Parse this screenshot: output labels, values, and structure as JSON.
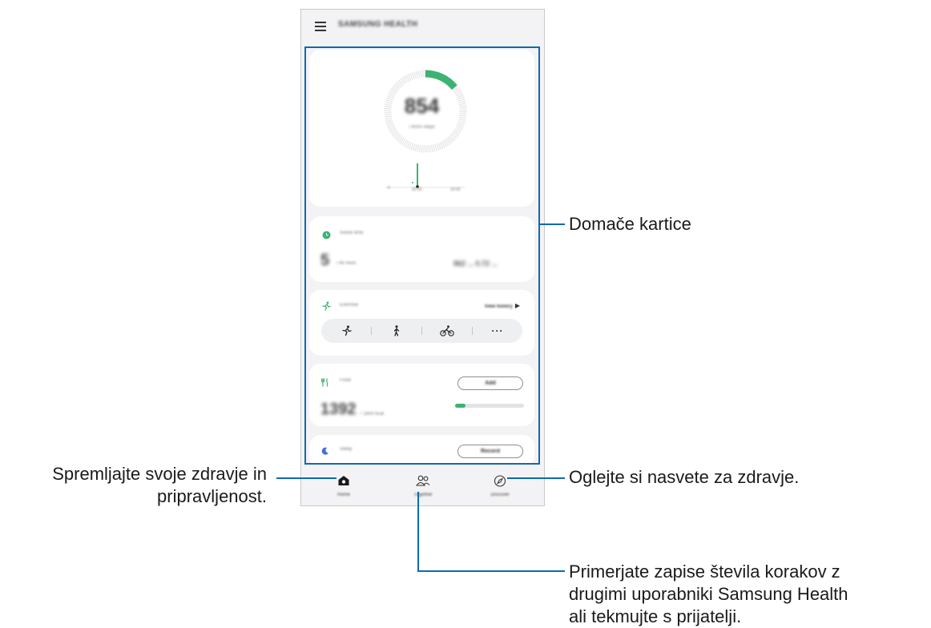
{
  "app": {
    "title": "SAMSUNG HEALTH"
  },
  "steps_card": {
    "count": "854",
    "goal": "/ 6000 steps",
    "goal_fraction": 0.14,
    "chart_times": [
      "0",
      "00:00",
      "24:00"
    ]
  },
  "active_time_card": {
    "label": "Active time",
    "value": "5",
    "goal": "/ 90 mins",
    "stats": "862 ...  0.72 ..."
  },
  "exercise_card": {
    "label": "Exercise",
    "history_label": "View history",
    "history_icon": "play-triangle-icon",
    "activities": [
      "running-icon",
      "walking-icon",
      "cycling-icon",
      "more-icon"
    ]
  },
  "food_card": {
    "label": "Food",
    "value": "1392",
    "goal": "/ 1800 kcal",
    "button_label": "Add",
    "progress_fraction": 0.15
  },
  "sleep_card": {
    "label": "Sleep",
    "button_label": "Record"
  },
  "bottom_nav": {
    "items": [
      {
        "label": "Home",
        "icon": "home-icon"
      },
      {
        "label": "Together",
        "icon": "people-icon"
      },
      {
        "label": "Discover",
        "icon": "compass-icon"
      }
    ]
  },
  "callouts": {
    "home_cards": "Domače kartice",
    "home_line1": "Spremljajte svoje zdravje in",
    "home_line2": "pripravljenost.",
    "discover": "Oglejte si nasvete za zdravje.",
    "together_line1": "Primerjate zapise števila korakov z",
    "together_line2": "drugimi uporabniki Samsung Health",
    "together_line3": "ali tekmujte s prijatelji."
  },
  "colors": {
    "accent_green": "#3cb371",
    "callout_blue": "#0e6ab0",
    "background_gray": "#f3f3f5"
  }
}
